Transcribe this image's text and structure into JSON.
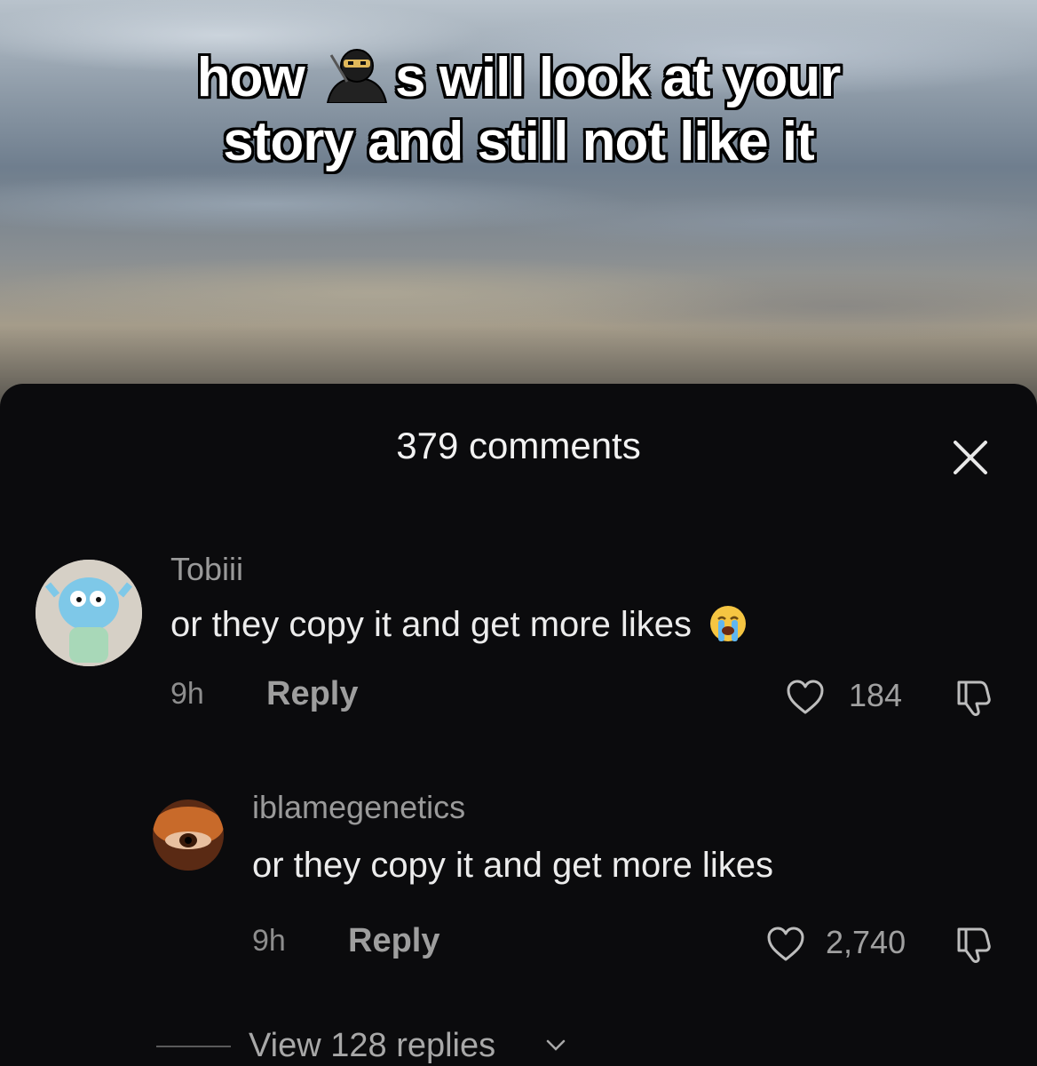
{
  "caption": {
    "line1_before": "how ",
    "line1_after": "s will look at your",
    "line2": "story and still not like it",
    "emoji_icon": "ninja-emoji"
  },
  "sheet": {
    "title": "379 comments",
    "close_icon": "close-icon"
  },
  "comments": [
    {
      "username": "Tobiii",
      "text": "or they copy it and get more likes",
      "emoji_icon": "loudly-crying-face-emoji",
      "time": "9h",
      "reply_label": "Reply",
      "like_count": "184"
    },
    {
      "username": "iblamegenetics",
      "text": "or they copy it and get more likes",
      "time": "9h",
      "reply_label": "Reply",
      "like_count": "2,740"
    }
  ],
  "view_replies": {
    "label": "View 128 replies"
  },
  "colors": {
    "sheet_background": "#0b0b0d",
    "primary_text": "#ececec",
    "secondary_text": "#9a9a9a"
  }
}
